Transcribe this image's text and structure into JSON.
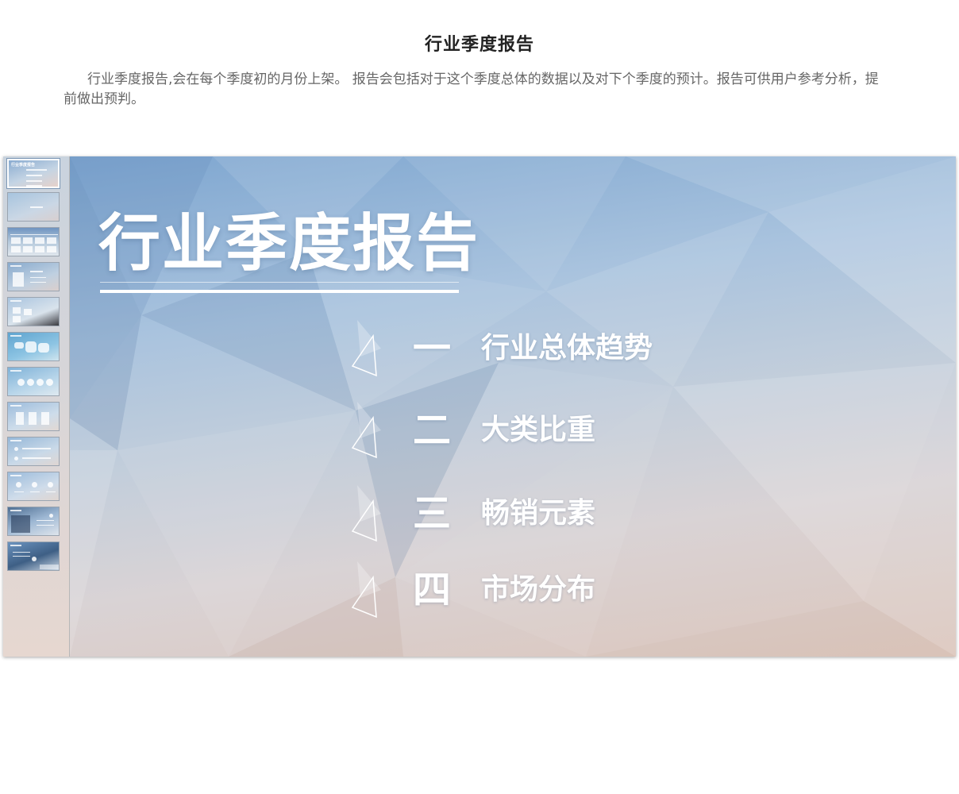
{
  "header": {
    "title": "行业季度报告",
    "description": "行业季度报告,会在每个季度初的月份上架。 报告会包括对于这个季度总体的数据以及对下个季度的预计。报告可供用户参考分析，提前做出预判。"
  },
  "thumbnails": {
    "count": 12,
    "selected_index": 1,
    "first_thumb_title": "行业季度报告"
  },
  "slide": {
    "title": "行业季度报告",
    "toc": [
      {
        "num": "一",
        "label": "行业总体趋势"
      },
      {
        "num": "二",
        "label": "大类比重"
      },
      {
        "num": "三",
        "label": "畅销元素"
      },
      {
        "num": "四",
        "label": "市场分布"
      }
    ]
  },
  "colors": {
    "slide_top": "#7ea6d0",
    "slide_bottom": "#dcc6bc",
    "text_white": "#ffffff"
  }
}
